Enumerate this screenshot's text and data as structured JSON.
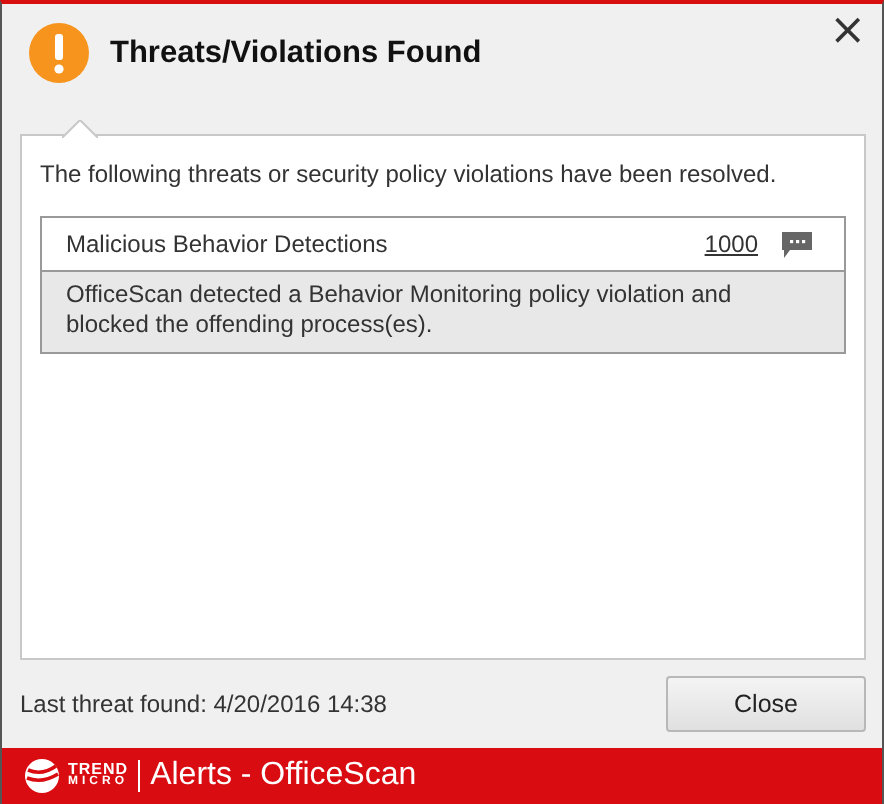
{
  "window": {
    "title": "Threats/Violations Found",
    "close": "×"
  },
  "message": "The following threats or security policy violations have been resolved.",
  "entries": [
    {
      "name": "Malicious Behavior Detections",
      "count": "1000",
      "description": "OfficeScan detected a Behavior Monitoring policy violation and blocked the offending process(es)."
    }
  ],
  "footer": {
    "last_found": "Last threat found: 4/20/2016 14:38",
    "button": "Close"
  },
  "brand_bar": {
    "logo_top": "TREND",
    "logo_bottom": "MICRO",
    "title": "Alerts - OfficeScan"
  }
}
